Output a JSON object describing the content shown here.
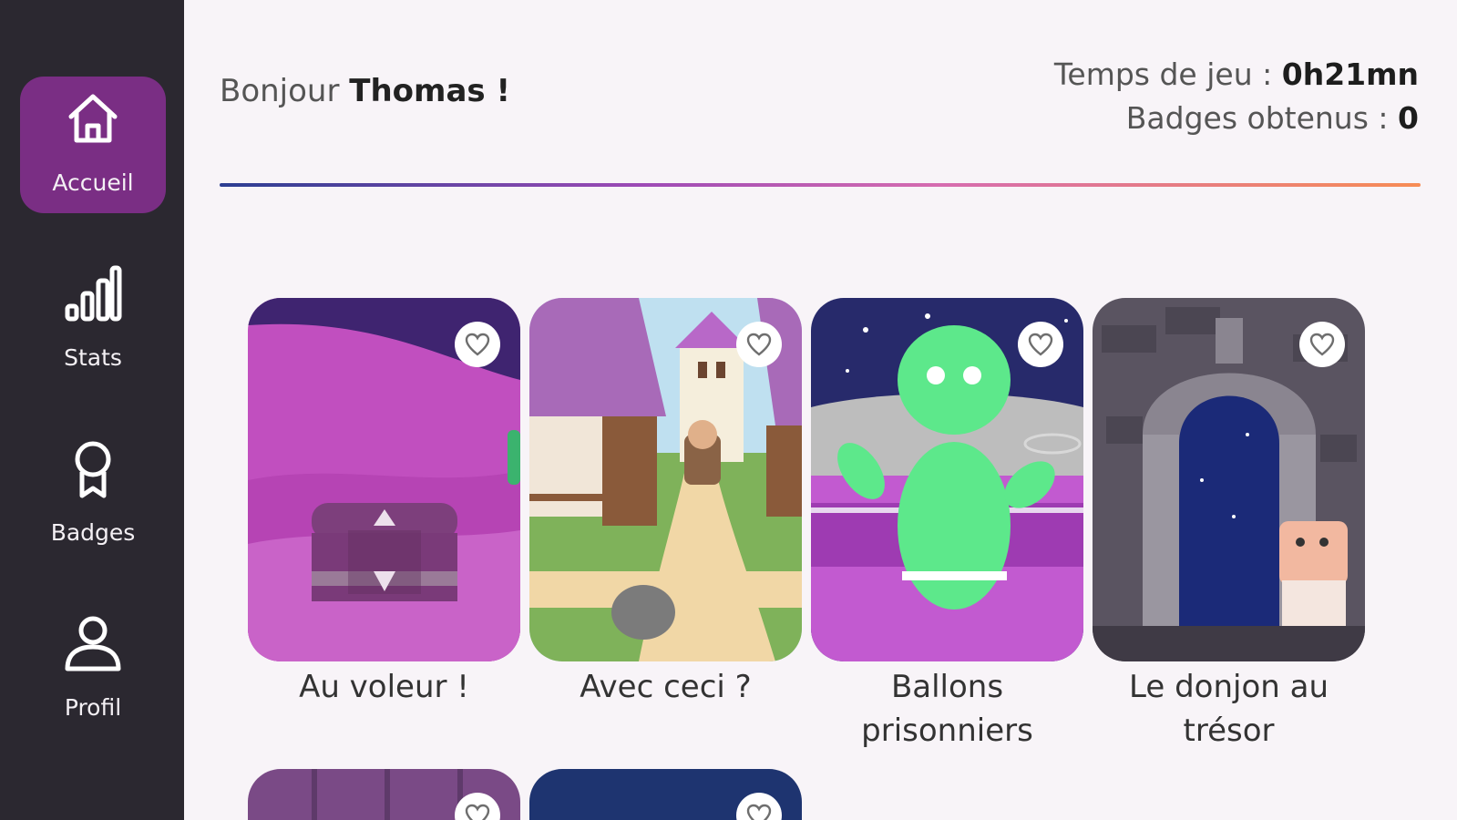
{
  "sidebar": {
    "items": [
      {
        "label": "Accueil",
        "icon": "home-icon",
        "active": true
      },
      {
        "label": "Stats",
        "icon": "bar-chart-icon",
        "active": false
      },
      {
        "label": "Badges",
        "icon": "badge-ribbon-icon",
        "active": false
      },
      {
        "label": "Profil",
        "icon": "user-icon",
        "active": false
      }
    ]
  },
  "header": {
    "greeting_prefix": "Bonjour",
    "user_name": "Thomas !",
    "playtime_label": "Temps de jeu :",
    "playtime_value": "0h21mn",
    "badges_label": "Badges obtenus :",
    "badges_value": "0"
  },
  "colors": {
    "sidebar_bg": "#2b2830",
    "active_nav": "#7a2e84",
    "page_bg": "#f8f4f8"
  },
  "games": [
    {
      "title": "Au voleur !",
      "favorite_icon": "heart-outline-icon"
    },
    {
      "title": "Avec ceci ?",
      "favorite_icon": "heart-outline-icon"
    },
    {
      "title": "Ballons prisonniers",
      "favorite_icon": "heart-outline-icon"
    },
    {
      "title": "Le donjon au trésor",
      "favorite_icon": "heart-outline-icon"
    },
    {
      "title": "",
      "favorite_icon": "heart-outline-icon"
    },
    {
      "title": "",
      "favorite_icon": "heart-outline-icon"
    }
  ]
}
